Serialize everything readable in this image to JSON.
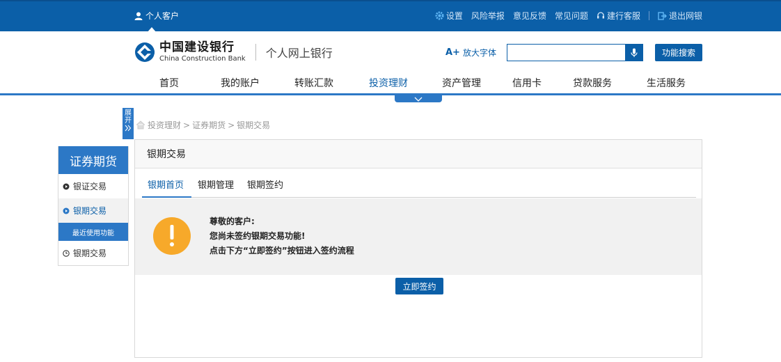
{
  "topbar": {
    "user_label": "个人客户",
    "links": [
      {
        "label": "设置",
        "icon": "gear-icon"
      },
      {
        "label": "风险举报",
        "icon": ""
      },
      {
        "label": "意见反馈",
        "icon": ""
      },
      {
        "label": "常见问题",
        "icon": ""
      },
      {
        "label": "建行客服",
        "icon": "headset-icon"
      },
      {
        "label": "退出网银",
        "icon": "logout-icon"
      }
    ]
  },
  "header": {
    "logo_cn": "中国建设银行",
    "logo_en": "China Construction Bank",
    "subtitle": "个人网上银行",
    "zoom_label": "放大字体",
    "zoom_prefix": "A+",
    "search_placeholder": "",
    "search_button": "功能搜索"
  },
  "nav": {
    "items": [
      "首页",
      "我的账户",
      "转账汇款",
      "投资理财",
      "资产管理",
      "信用卡",
      "贷款服务",
      "生活服务"
    ],
    "active": "投资理财"
  },
  "expand_tab": {
    "label": "展开"
  },
  "breadcrumb": {
    "items": [
      "投资理财",
      "证券期货",
      "银期交易"
    ]
  },
  "left_menu": {
    "title": "证券期货",
    "items": [
      {
        "label": "银证交易",
        "active": false
      },
      {
        "label": "银期交易",
        "active": true
      }
    ],
    "recent_title": "最近使用功能",
    "recent_items": [
      {
        "label": "银期交易"
      }
    ]
  },
  "panel": {
    "title": "银期交易",
    "tabs": [
      "银期首页",
      "银期管理",
      "银期签约"
    ],
    "active_tab": "银期首页",
    "notice": {
      "line1": "尊敬的客户:",
      "line2": "您尚未签约银期交易功能!",
      "line3": "点击下方“立即签约”按钮进入签约流程"
    },
    "sign_button": "立即签约"
  },
  "colors": {
    "brand": "#0b5fa8",
    "accent": "#2c78c6",
    "warning": "#f7a92a"
  }
}
